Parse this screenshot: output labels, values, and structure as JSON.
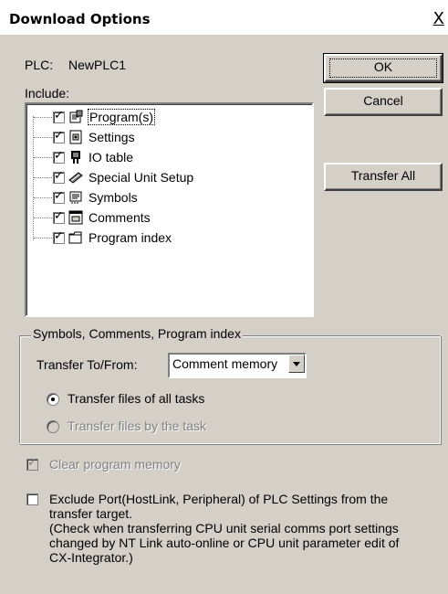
{
  "window": {
    "title": "Download Options",
    "close_label": "X"
  },
  "plc": {
    "label": "PLC:",
    "name": "NewPLC1"
  },
  "include_label": "Include:",
  "buttons": {
    "ok": "OK",
    "cancel": "Cancel",
    "transfer_all": "Transfer All"
  },
  "tree": {
    "items": [
      {
        "label": "Program(s)",
        "checked": true,
        "selected": true,
        "icon": "program-icon"
      },
      {
        "label": "Settings",
        "checked": true,
        "icon": "settings-icon"
      },
      {
        "label": "IO table",
        "checked": true,
        "icon": "io-table-icon"
      },
      {
        "label": "Special Unit Setup",
        "checked": true,
        "icon": "special-unit-icon"
      },
      {
        "label": "Symbols",
        "checked": true,
        "icon": "symbols-icon"
      },
      {
        "label": "Comments",
        "checked": true,
        "icon": "comments-icon"
      },
      {
        "label": "Program index",
        "checked": true,
        "icon": "folder-icon"
      }
    ]
  },
  "group": {
    "title": "Symbols, Comments, Program index",
    "transfer_label": "Transfer To/From:",
    "transfer_value": "Comment memory",
    "radio_all_tasks": "Transfer files of all tasks",
    "radio_by_task": "Transfer files by the task",
    "radio_all_selected": true
  },
  "clear_memory": {
    "label": "Clear program memory",
    "checked": true,
    "disabled": true
  },
  "exclude_port": {
    "checked": false,
    "line1": "Exclude Port(HostLink, Peripheral) of PLC Settings from the",
    "line2": "transfer target.",
    "line3": "(Check when transferring CPU unit serial comms port settings",
    "line4": "changed by NT Link auto-online or CPU unit parameter edit of",
    "line5": "CX-Integrator.)"
  }
}
